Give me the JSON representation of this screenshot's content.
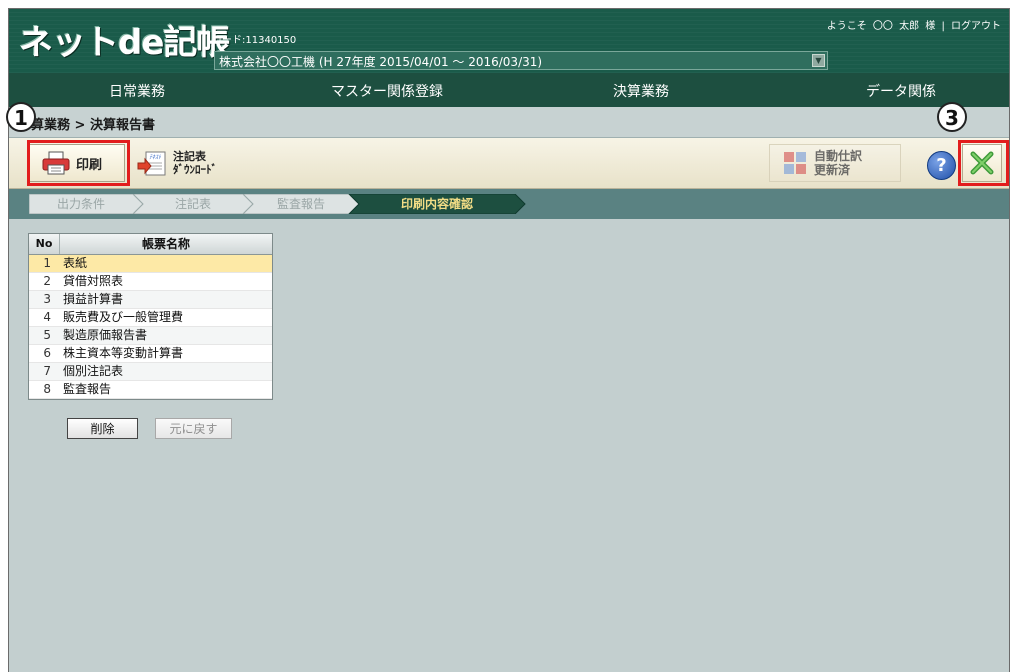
{
  "header": {
    "logo": "ネットde記帳",
    "code_label": "コード:11340150",
    "company": "株式会社〇〇工機 (H 27年度 2015/04/01 ～ 2016/03/31)",
    "user_bar": "ようこそ 〇〇 太郎 様 | ログアウト"
  },
  "menu": {
    "items": [
      "日常業務",
      "マスター関係登録",
      "決算業務",
      "データ関係"
    ]
  },
  "breadcrumb": "算業務 > 決算報告書",
  "toolbar": {
    "print_label": "印刷",
    "notes_label": "注記表\nﾀﾞｳﾝﾛｰﾄﾞ",
    "auto_label": "自動仕訳\n更新済",
    "help_label": "?"
  },
  "steps": [
    "出力条件",
    "注記表",
    "監査報告",
    "印刷内容確認"
  ],
  "active_step": 3,
  "table": {
    "headers": {
      "no": "No",
      "name": "帳票名称"
    },
    "rows": [
      {
        "no": "1",
        "name": "表紙",
        "selected": true
      },
      {
        "no": "2",
        "name": "貸借対照表"
      },
      {
        "no": "3",
        "name": "損益計算書"
      },
      {
        "no": "4",
        "name": "販売費及び一般管理費"
      },
      {
        "no": "5",
        "name": "製造原価報告書"
      },
      {
        "no": "6",
        "name": "株主資本等変動計算書"
      },
      {
        "no": "7",
        "name": "個別注記表"
      },
      {
        "no": "8",
        "name": "監査報告"
      }
    ]
  },
  "buttons": {
    "delete": "削除",
    "revert": "元に戻す"
  },
  "markers": {
    "m1": "1",
    "m3": "3"
  },
  "colors": {
    "header": "#1a5b4a",
    "menu": "#1d4f40",
    "highlight": "#e21d1d",
    "selected_row": "#fde9a6",
    "step_active": "#1d4f40"
  }
}
